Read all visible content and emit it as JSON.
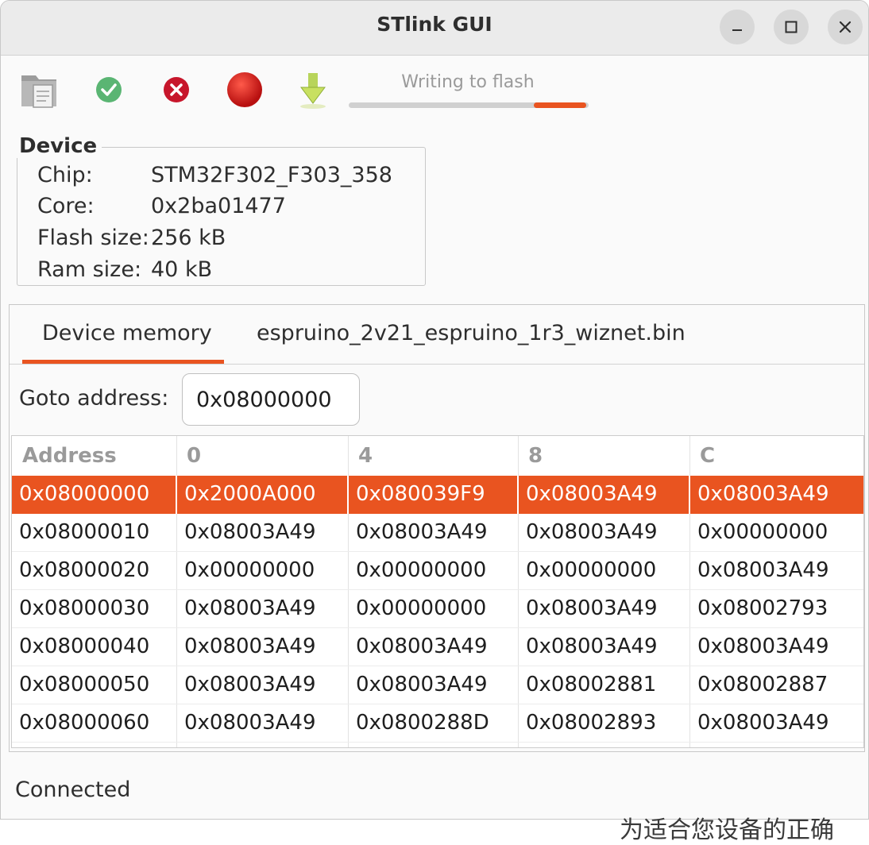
{
  "window": {
    "title": "STlink GUI"
  },
  "toolbar": {
    "icons": [
      "open-file-icon",
      "connect-icon",
      "disconnect-icon",
      "record-icon",
      "flash-download-icon"
    ],
    "progress": {
      "label": "Writing to flash",
      "fill_start": 0.77,
      "fill_end": 0.99,
      "color": "#e95420"
    }
  },
  "device": {
    "legend": "Device",
    "rows": [
      {
        "label": "Chip:",
        "value": "STM32F302_F303_358"
      },
      {
        "label": "Core:",
        "value": "0x2ba01477"
      },
      {
        "label": "Flash size:",
        "value": "256 kB"
      },
      {
        "label": "Ram size:",
        "value": "40 kB"
      }
    ]
  },
  "tabs": [
    {
      "label": "Device memory",
      "active": true
    },
    {
      "label": "espruino_2v21_espruino_1r3_wiznet.bin",
      "active": false
    }
  ],
  "goto": {
    "label": "Goto address:",
    "value": "0x08000000"
  },
  "memory_table": {
    "columns": [
      "Address",
      "0",
      "4",
      "8",
      "C"
    ],
    "selected_row": 0,
    "rows": [
      [
        "0x08000000",
        "0x2000A000",
        "0x080039F9",
        "0x08003A49",
        "0x08003A49"
      ],
      [
        "0x08000010",
        "0x08003A49",
        "0x08003A49",
        "0x08003A49",
        "0x00000000"
      ],
      [
        "0x08000020",
        "0x00000000",
        "0x00000000",
        "0x00000000",
        "0x08003A49"
      ],
      [
        "0x08000030",
        "0x08003A49",
        "0x00000000",
        "0x08003A49",
        "0x08002793"
      ],
      [
        "0x08000040",
        "0x08003A49",
        "0x08003A49",
        "0x08003A49",
        "0x08003A49"
      ],
      [
        "0x08000050",
        "0x08003A49",
        "0x08003A49",
        "0x08002881",
        "0x08002887"
      ],
      [
        "0x08000060",
        "0x08003A49",
        "0x0800288D",
        "0x08002893",
        "0x08003A49"
      ]
    ]
  },
  "status": {
    "text": "Connected"
  },
  "background": {
    "partial_text": "为适合您设备的正确"
  },
  "colors": {
    "accent": "#e95420",
    "connect": "#5ab573",
    "disconnect": "#c7162b"
  }
}
